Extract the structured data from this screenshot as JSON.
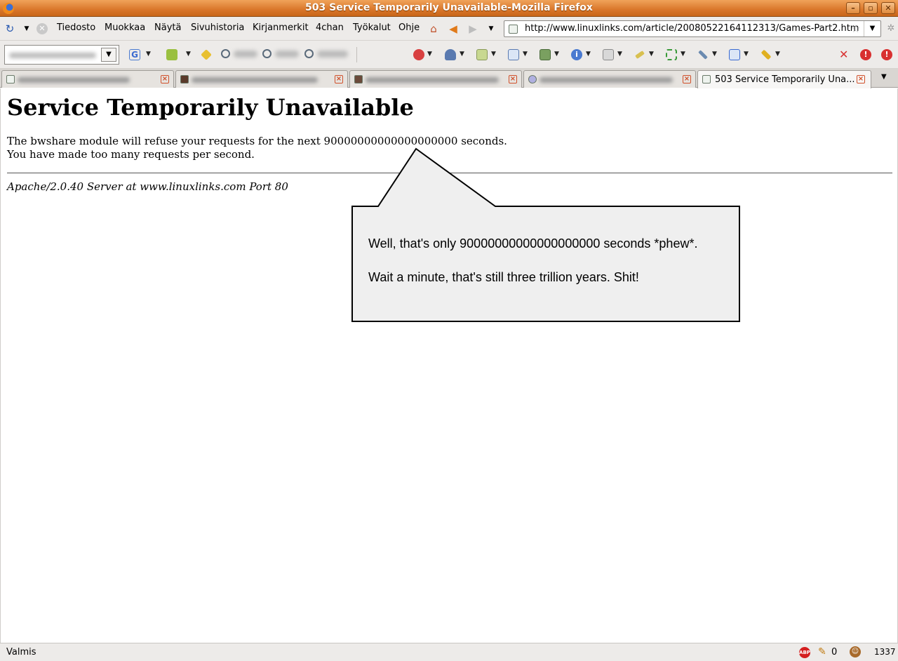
{
  "window": {
    "title": "503 Service Temporarily Unavailable-Mozilla Firefox",
    "buttons": [
      "–",
      "▫",
      "✕"
    ]
  },
  "menubar": {
    "items": [
      "Tiedosto",
      "Muokkaa",
      "Näytä",
      "Sivuhistoria",
      "Kirjanmerkit",
      "4chan",
      "Työkalut",
      "Ohje"
    ],
    "url": "http://www.linuxlinks.com/article/20080522164112313/Games-Part2.htm"
  },
  "tabs": {
    "active_label": "503 Service Temporarily Una..."
  },
  "page": {
    "title": "Service Temporarily Unavailable",
    "line1": "The bwshare module will refuse your requests for the next 90000000000000000000 seconds.",
    "line2": "You have made too many requests per second.",
    "signature": "Apache/2.0.40 Server at www.linuxlinks.com Port 80"
  },
  "bubble": {
    "line1": "Well, that's only 90000000000000000000 seconds *phew*.",
    "line2": "Wait a minute, that's still three trillion years. Shit!"
  },
  "statusbar": {
    "status": "Valmis",
    "abp_label": "ABP",
    "counter": "0",
    "number": "1337"
  }
}
